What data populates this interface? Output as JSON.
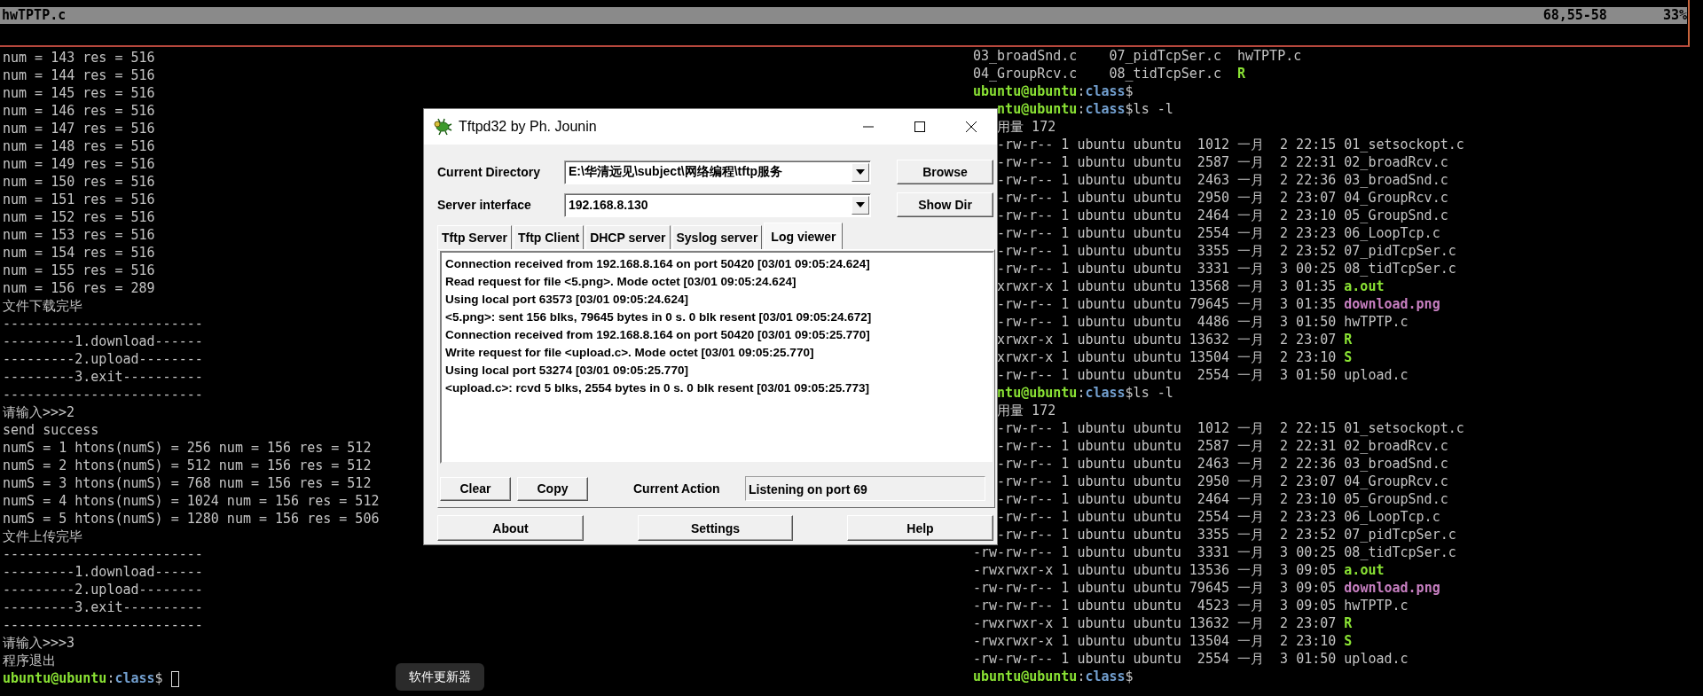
{
  "vim_status": {
    "filename": "hwTPTP.c",
    "position": "68,55-58",
    "percent": "33%"
  },
  "left_pane": {
    "lines": [
      {
        "kind": "text",
        "text": "num = 143 res = 516"
      },
      {
        "kind": "text",
        "text": "num = 144 res = 516"
      },
      {
        "kind": "text",
        "text": "num = 145 res = 516"
      },
      {
        "kind": "text",
        "text": "num = 146 res = 516"
      },
      {
        "kind": "text",
        "text": "num = 147 res = 516"
      },
      {
        "kind": "text",
        "text": "num = 148 res = 516"
      },
      {
        "kind": "text",
        "text": "num = 149 res = 516"
      },
      {
        "kind": "text",
        "text": "num = 150 res = 516"
      },
      {
        "kind": "text",
        "text": "num = 151 res = 516"
      },
      {
        "kind": "text",
        "text": "num = 152 res = 516"
      },
      {
        "kind": "text",
        "text": "num = 153 res = 516"
      },
      {
        "kind": "text",
        "text": "num = 154 res = 516"
      },
      {
        "kind": "text",
        "text": "num = 155 res = 516"
      },
      {
        "kind": "text",
        "text": "num = 156 res = 289"
      },
      {
        "kind": "text",
        "text": "文件下载完毕"
      },
      {
        "kind": "text",
        "text": "-------------------------"
      },
      {
        "kind": "text",
        "text": "---------1.download------"
      },
      {
        "kind": "text",
        "text": "---------2.upload--------"
      },
      {
        "kind": "text",
        "text": "---------3.exit----------"
      },
      {
        "kind": "text",
        "text": "-------------------------"
      },
      {
        "kind": "text",
        "text": "请输入>>>2"
      },
      {
        "kind": "text",
        "text": "send success"
      },
      {
        "kind": "text",
        "text": "numS = 1 htons(numS) = 256 num = 156 res = 512"
      },
      {
        "kind": "text",
        "text": "numS = 2 htons(numS) = 512 num = 156 res = 512"
      },
      {
        "kind": "text",
        "text": "numS = 3 htons(numS) = 768 num = 156 res = 512"
      },
      {
        "kind": "text",
        "text": "numS = 4 htons(numS) = 1024 num = 156 res = 512"
      },
      {
        "kind": "text",
        "text": "numS = 5 htons(numS) = 1280 num = 156 res = 506"
      },
      {
        "kind": "text",
        "text": "文件上传完毕"
      },
      {
        "kind": "text",
        "text": "-------------------------"
      },
      {
        "kind": "text",
        "text": "---------1.download------"
      },
      {
        "kind": "text",
        "text": "---------2.upload--------"
      },
      {
        "kind": "text",
        "text": "---------3.exit----------"
      },
      {
        "kind": "text",
        "text": "-------------------------"
      },
      {
        "kind": "text",
        "text": "请输入>>>3"
      },
      {
        "kind": "text",
        "text": "程序退出"
      },
      {
        "kind": "prompt",
        "user": "ubuntu@ubuntu",
        "colon": ":",
        "path": "class",
        "dollar": "$",
        "cursor": true
      }
    ]
  },
  "right_pane": {
    "lines": [
      {
        "kind": "columns",
        "covered": false,
        "items": [
          {
            "name": "03_broadSnd.c",
            "color": "#c4c4c4",
            "bold": false
          },
          {
            "name": "07_pidTcpSer.c",
            "color": "#c4c4c4",
            "bold": false
          },
          {
            "name": "hwTPTP.c",
            "color": "#c4c4c4",
            "bold": false
          }
        ]
      },
      {
        "kind": "columns",
        "covered": false,
        "items": [
          {
            "name": "04_GroupRcv.c",
            "color": "#c4c4c4",
            "bold": false
          },
          {
            "name": "08_tidTcpSer.c",
            "color": "#c4c4c4",
            "bold": false
          },
          {
            "name": "R",
            "color": "#8ae234",
            "bold": true
          }
        ]
      },
      {
        "kind": "prompt",
        "covered": false,
        "user": "ubuntu@ubuntu",
        "colon": ":",
        "path": "class",
        "dollar": "$"
      },
      {
        "kind": "prompt",
        "covered": true,
        "user": "ntu@ubuntu",
        "colon": ":",
        "path": "class",
        "dollar": "$",
        "command": "ls -l"
      },
      {
        "kind": "text",
        "covered": true,
        "text": "用量 172"
      },
      {
        "kind": "entry",
        "covered": true,
        "info": "-rw-r-- 1 ubuntu ubuntu  1012 一月  2 22:15",
        "name": "01_setsockopt.c",
        "color": "#c4c4c4",
        "bold": false
      },
      {
        "kind": "entry",
        "covered": true,
        "info": "-rw-r-- 1 ubuntu ubuntu  2587 一月  2 22:31",
        "name": "02_broadRcv.c",
        "color": "#c4c4c4",
        "bold": false
      },
      {
        "kind": "entry",
        "covered": true,
        "info": "-rw-r-- 1 ubuntu ubuntu  2463 一月  2 22:36",
        "name": "03_broadSnd.c",
        "color": "#c4c4c4",
        "bold": false
      },
      {
        "kind": "entry",
        "covered": true,
        "info": "-rw-r-- 1 ubuntu ubuntu  2950 一月  2 23:07",
        "name": "04_GroupRcv.c",
        "color": "#c4c4c4",
        "bold": false
      },
      {
        "kind": "entry",
        "covered": true,
        "info": "-rw-r-- 1 ubuntu ubuntu  2464 一月  2 23:10",
        "name": "05_GroupSnd.c",
        "color": "#c4c4c4",
        "bold": false
      },
      {
        "kind": "entry",
        "covered": true,
        "info": "-rw-r-- 1 ubuntu ubuntu  2554 一月  2 23:23",
        "name": "06_LoopTcp.c",
        "color": "#c4c4c4",
        "bold": false
      },
      {
        "kind": "entry",
        "covered": true,
        "info": "-rw-r-- 1 ubuntu ubuntu  3355 一月  2 23:52",
        "name": "07_pidTcpSer.c",
        "color": "#c4c4c4",
        "bold": false
      },
      {
        "kind": "entry",
        "covered": true,
        "info": "-rw-r-- 1 ubuntu ubuntu  3331 一月  3 00:25",
        "name": "08_tidTcpSer.c",
        "color": "#c4c4c4",
        "bold": false
      },
      {
        "kind": "entry",
        "covered": true,
        "info": "xrwxr-x 1 ubuntu ubuntu 13568 一月  3 01:35",
        "name": "a.out",
        "color": "#8ae234",
        "bold": true
      },
      {
        "kind": "entry",
        "covered": true,
        "info": "-rw-r-- 1 ubuntu ubuntu 79645 一月  3 01:35",
        "name": "download.png",
        "color": "#c77fc1",
        "bold": true
      },
      {
        "kind": "entry",
        "covered": true,
        "info": "-rw-r-- 1 ubuntu ubuntu  4486 一月  3 01:50",
        "name": "hwTPTP.c",
        "color": "#c4c4c4",
        "bold": false
      },
      {
        "kind": "entry",
        "covered": true,
        "info": "xrwxr-x 1 ubuntu ubuntu 13632 一月  2 23:07",
        "name": "R",
        "color": "#8ae234",
        "bold": true
      },
      {
        "kind": "entry",
        "covered": true,
        "info": "xrwxr-x 1 ubuntu ubuntu 13504 一月  2 23:10",
        "name": "S",
        "color": "#8ae234",
        "bold": true
      },
      {
        "kind": "entry",
        "covered": true,
        "info": "-rw-r-- 1 ubuntu ubuntu  2554 一月  3 01:50",
        "name": "upload.c",
        "color": "#c4c4c4",
        "bold": false
      },
      {
        "kind": "prompt",
        "covered": true,
        "user": "ntu@ubuntu",
        "colon": ":",
        "path": "class",
        "dollar": "$",
        "command": "ls -l"
      },
      {
        "kind": "text",
        "covered": true,
        "text": "用量 172"
      },
      {
        "kind": "entry",
        "covered": true,
        "info": "-rw-r-- 1 ubuntu ubuntu  1012 一月  2 22:15",
        "name": "01_setsockopt.c",
        "color": "#c4c4c4",
        "bold": false
      },
      {
        "kind": "entry",
        "covered": true,
        "info": "-rw-r-- 1 ubuntu ubuntu  2587 一月  2 22:31",
        "name": "02_broadRcv.c",
        "color": "#c4c4c4",
        "bold": false
      },
      {
        "kind": "entry",
        "covered": true,
        "info": "-rw-r-- 1 ubuntu ubuntu  2463 一月  2 22:36",
        "name": "03_broadSnd.c",
        "color": "#c4c4c4",
        "bold": false
      },
      {
        "kind": "entry",
        "covered": true,
        "info": "-rw-r-- 1 ubuntu ubuntu  2950 一月  2 23:07",
        "name": "04_GroupRcv.c",
        "color": "#c4c4c4",
        "bold": false
      },
      {
        "kind": "entry",
        "covered": true,
        "info": "-rw-r-- 1 ubuntu ubuntu  2464 一月  2 23:10",
        "name": "05_GroupSnd.c",
        "color": "#c4c4c4",
        "bold": false
      },
      {
        "kind": "entry",
        "covered": true,
        "info": "-rw-r-- 1 ubuntu ubuntu  2554 一月  2 23:23",
        "name": "06_LoopTcp.c",
        "color": "#c4c4c4",
        "bold": false
      },
      {
        "kind": "entry",
        "covered": true,
        "info": "-rw-r-- 1 ubuntu ubuntu  3355 一月  2 23:52",
        "name": "07_pidTcpSer.c",
        "color": "#c4c4c4",
        "bold": false
      },
      {
        "kind": "entry",
        "covered": false,
        "info": "-rw-rw-r-- 1 ubuntu ubuntu  3331 一月  3 00:25",
        "name": "08_tidTcpSer.c",
        "color": "#c4c4c4",
        "bold": false
      },
      {
        "kind": "entry",
        "covered": false,
        "info": "-rwxrwxr-x 1 ubuntu ubuntu 13536 一月  3 09:05",
        "name": "a.out",
        "color": "#8ae234",
        "bold": true
      },
      {
        "kind": "entry",
        "covered": false,
        "info": "-rw-rw-r-- 1 ubuntu ubuntu 79645 一月  3 09:05",
        "name": "download.png",
        "color": "#c77fc1",
        "bold": true
      },
      {
        "kind": "entry",
        "covered": false,
        "info": "-rw-rw-r-- 1 ubuntu ubuntu  4523 一月  3 09:05",
        "name": "hwTPTP.c",
        "color": "#c4c4c4",
        "bold": false
      },
      {
        "kind": "entry",
        "covered": false,
        "info": "-rwxrwxr-x 1 ubuntu ubuntu 13632 一月  2 23:07",
        "name": "R",
        "color": "#8ae234",
        "bold": true
      },
      {
        "kind": "entry",
        "covered": false,
        "info": "-rwxrwxr-x 1 ubuntu ubuntu 13504 一月  2 23:10",
        "name": "S",
        "color": "#8ae234",
        "bold": true
      },
      {
        "kind": "entry",
        "covered": false,
        "info": "-rw-rw-r-- 1 ubuntu ubuntu  2554 一月  3 01:50",
        "name": "upload.c",
        "color": "#c4c4c4",
        "bold": false
      },
      {
        "kind": "prompt",
        "covered": false,
        "user": "ubuntu@ubuntu",
        "colon": ":",
        "path": "class",
        "dollar": "$"
      }
    ]
  },
  "dialog": {
    "title": "Tftpd32 by Ph. Jounin",
    "fields": [
      {
        "label": "Current Directory",
        "value": "E:\\华清远见\\subject\\网络编程\\tftp服务",
        "button": "Browse"
      },
      {
        "label": "Server interface",
        "value": "192.168.8.130",
        "button": "Show Dir"
      }
    ],
    "tabs": [
      {
        "label": "Tftp Server",
        "selected": false
      },
      {
        "label": "Tftp Client",
        "selected": false
      },
      {
        "label": "DHCP server",
        "selected": false
      },
      {
        "label": "Syslog server",
        "selected": false
      },
      {
        "label": "Log viewer",
        "selected": true
      }
    ],
    "log": [
      "Connection received from 192.168.8.164 on port 50420 [03/01 09:05:24.624]",
      "Read request for file <5.png>. Mode octet [03/01 09:05:24.624]",
      "Using local port 63573 [03/01 09:05:24.624]",
      "<5.png>: sent 156 blks, 79645 bytes in 0 s. 0 blk resent [03/01 09:05:24.672]",
      "Connection received from 192.168.8.164 on port 50420 [03/01 09:05:25.770]",
      "Write request for file <upload.c>. Mode octet [03/01 09:05:25.770]",
      "Using local port 53274 [03/01 09:05:25.770]",
      "<upload.c>: rcvd 5 blks, 2554 bytes in 0 s. 0 blk resent [03/01 09:05:25.773]"
    ],
    "log_buttons": [
      "Clear",
      "Copy"
    ],
    "current_action": {
      "label": "Current Action",
      "value": "Listening on port 69"
    },
    "bottom_buttons": [
      "About",
      "Settings",
      "Help"
    ]
  },
  "tooltip": "软件更新器"
}
